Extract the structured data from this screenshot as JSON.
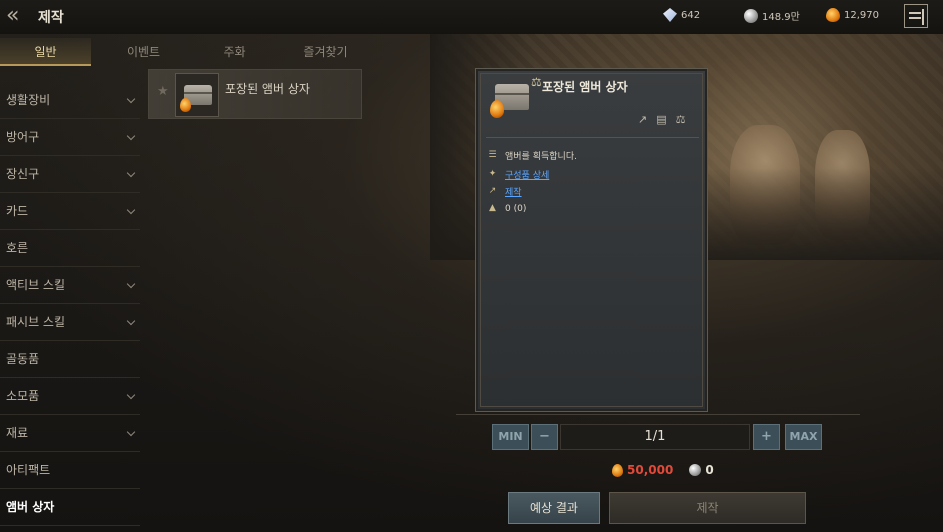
{
  "header": {
    "title": "제작",
    "currencies": {
      "diamond": {
        "icon": "diamond-icon",
        "value": "642"
      },
      "silver": {
        "icon": "silver-icon",
        "value": "148.9만"
      },
      "amber": {
        "icon": "amber-icon",
        "value": "12,970"
      }
    }
  },
  "tabs": [
    {
      "label": "일반",
      "active": true
    },
    {
      "label": "이벤트",
      "active": false
    },
    {
      "label": "주화",
      "active": false
    },
    {
      "label": "즐겨찾기",
      "active": false
    }
  ],
  "sidebar": {
    "items": [
      {
        "label": "생활장비",
        "expandable": true
      },
      {
        "label": "방어구",
        "expandable": true
      },
      {
        "label": "장신구",
        "expandable": true
      },
      {
        "label": "카드",
        "expandable": true
      },
      {
        "label": "호른",
        "expandable": false
      },
      {
        "label": "액티브 스킬",
        "expandable": true
      },
      {
        "label": "패시브 스킬",
        "expandable": true
      },
      {
        "label": "골동품",
        "expandable": false
      },
      {
        "label": "소모품",
        "expandable": true
      },
      {
        "label": "재료",
        "expandable": true
      },
      {
        "label": "아티팩트",
        "expandable": false
      },
      {
        "label": "앰버 상자",
        "expandable": false,
        "active": true
      }
    ]
  },
  "recipe_list": [
    {
      "name": "포장된 앰버 상자"
    }
  ],
  "detail": {
    "title": "포장된 앰버 상자",
    "rows": [
      {
        "icon": "list-icon",
        "text": "앰버를 획득합니다."
      },
      {
        "icon": "compose-icon",
        "text": "구성품 상세",
        "link": true
      },
      {
        "icon": "craft-icon",
        "text": "제작",
        "link": true
      },
      {
        "icon": "weight-icon",
        "text": "0 (0)"
      }
    ]
  },
  "quantity": {
    "min_label": "MIN",
    "minus_label": "−",
    "value": "1/1",
    "plus_label": "+",
    "max_label": "MAX"
  },
  "cost": {
    "amber": "50,000",
    "silver": "0"
  },
  "buttons": {
    "preview": "예상 결과",
    "craft": "제작"
  },
  "colors": {
    "accent": "#b79a5a",
    "link": "#5aa5ff",
    "amber_cost": "#e14a3a"
  }
}
